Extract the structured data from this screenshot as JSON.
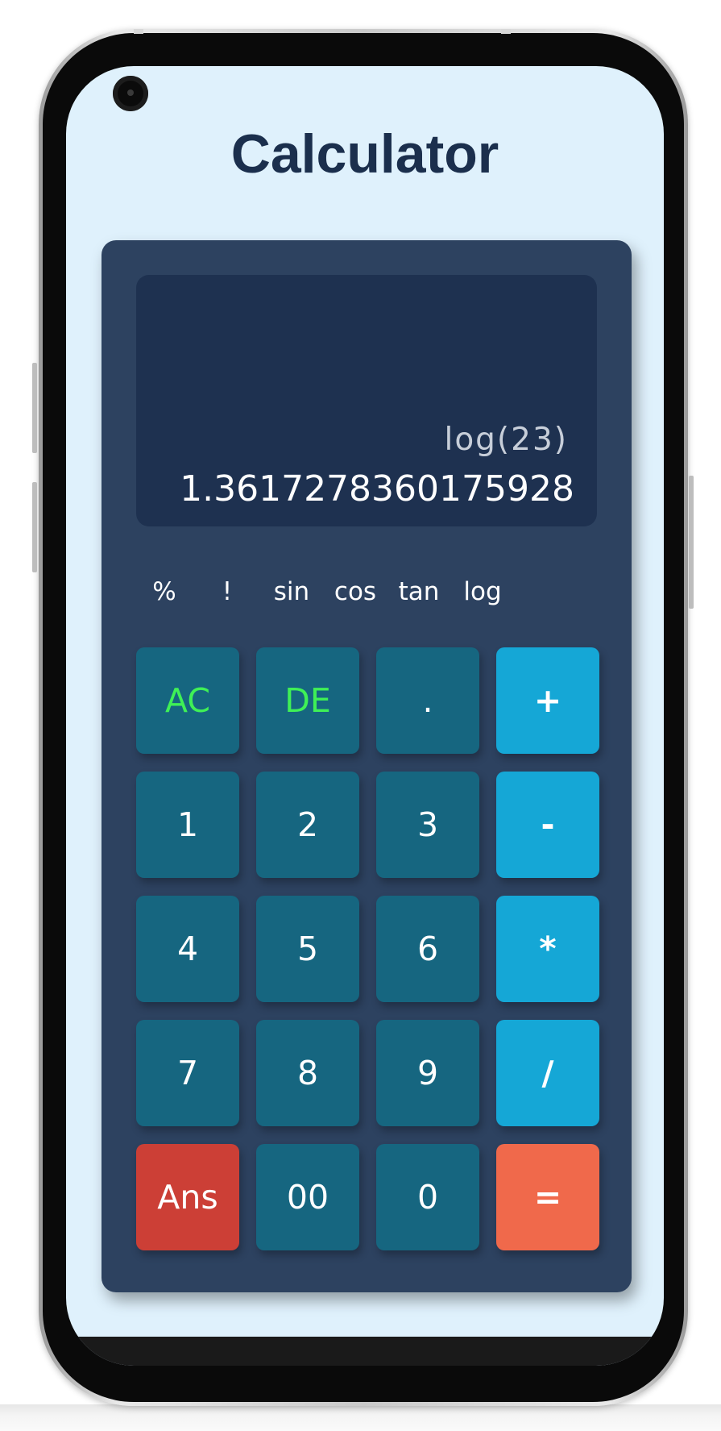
{
  "app": {
    "title": "Calculator"
  },
  "display": {
    "expression": "log(23)",
    "result": "1.3617278360175928"
  },
  "functions": [
    "%",
    "!",
    "sin",
    "cos",
    "tan",
    "log"
  ],
  "keys": {
    "ac": "AC",
    "de": "DE",
    "dot": ".",
    "plus": "+",
    "one": "1",
    "two": "2",
    "three": "3",
    "minus": "-",
    "four": "4",
    "five": "5",
    "six": "6",
    "multiply": "*",
    "seven": "7",
    "eight": "8",
    "nine": "9",
    "divide": "/",
    "ans": "Ans",
    "double_zero": "00",
    "zero": "0",
    "equals": "="
  },
  "colors": {
    "screen_background": "#dff1fc",
    "title": "#1b2f4d",
    "calculator_body": "#2d4260",
    "display": "#1e3150",
    "number_key": "#166680",
    "operator_key": "#15a7d6",
    "ans_key": "#cc3f36",
    "equals_key": "#f0694b",
    "clear_text": "#3ff056"
  }
}
